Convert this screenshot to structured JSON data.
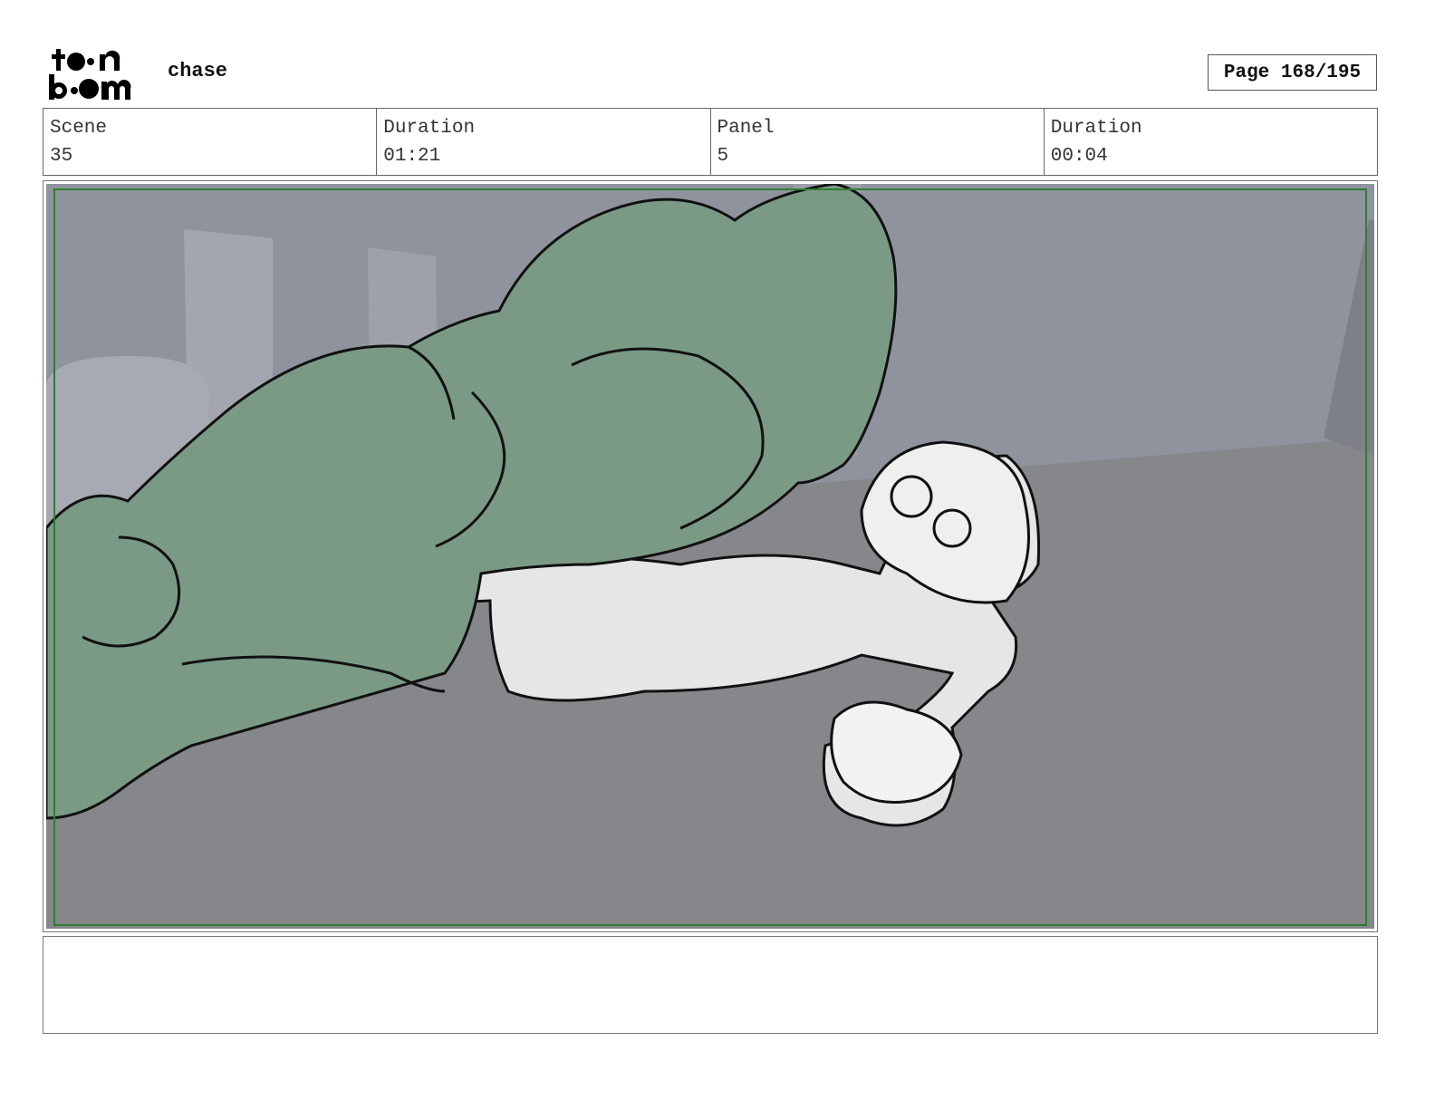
{
  "header": {
    "logo_text": "toon boom",
    "project_title": "chase",
    "page_indicator": "Page 168/195"
  },
  "info": {
    "scene_label": "Scene",
    "scene_value": "35",
    "scene_duration_label": "Duration",
    "scene_duration_value": "01:21",
    "panel_label": "Panel",
    "panel_value": "5",
    "panel_duration_label": "Duration",
    "panel_duration_value": "00:04"
  },
  "notes": {
    "text": ""
  },
  "colors": {
    "safe_frame": "#2e7d32",
    "creature_fill": "#7a9a86",
    "background": "#8e9098"
  }
}
